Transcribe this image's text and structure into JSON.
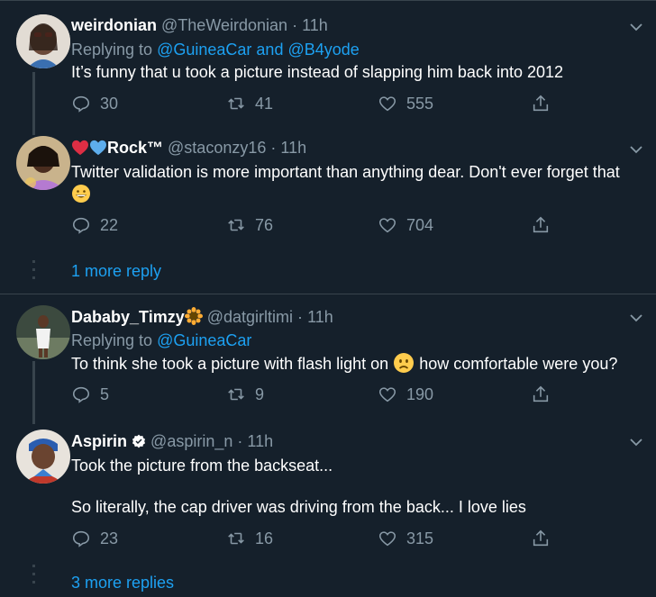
{
  "tweets": [
    {
      "name": "weirdonian",
      "handle": "@TheWeirdonian",
      "time": "11h",
      "replying_prefix": "Replying to",
      "mention1": "@GuineaCar",
      "mention_join": "and",
      "mention2": "@B4yode",
      "text": "It’s funny that u took a picture instead of slapping him back into 2012",
      "replies": "30",
      "retweets": "41",
      "likes": "555"
    },
    {
      "name": "Rock™",
      "handle": "@staconzy16",
      "time": "11h",
      "text": "Twitter validation is more important than anything dear. Don't ever forget that",
      "replies": "22",
      "retweets": "76",
      "likes": "704",
      "more_label": "1 more reply"
    },
    {
      "name": "Dababy_Timzy",
      "handle": "@datgirltimi",
      "time": "11h",
      "replying_prefix": "Replying to",
      "mention1": "@GuineaCar",
      "text_a": "To think she took a picture with flash light on",
      "text_b": "how comfortable were you?",
      "replies": "5",
      "retweets": "9",
      "likes": "190"
    },
    {
      "name": "Aspirin",
      "handle": "@aspirin_n",
      "time": "11h",
      "text_line1": "Took the picture from the backseat...",
      "text_line2": "So literally, the cap driver was driving from the back... I love lies",
      "replies": "23",
      "retweets": "16",
      "likes": "315",
      "more_label": "3 more replies"
    }
  ],
  "colors": {
    "background": "#15202b",
    "secondary_text": "#8899a6",
    "link": "#1da1f2",
    "divider": "#38444d"
  },
  "icons": [
    "reply-icon",
    "retweet-icon",
    "like-icon",
    "share-icon",
    "chevron-down-icon",
    "verified-badge-icon",
    "sunflower-emoji",
    "grinning-emoji",
    "worried-emoji",
    "red-heart-emoji",
    "blue-heart-emoji"
  ]
}
